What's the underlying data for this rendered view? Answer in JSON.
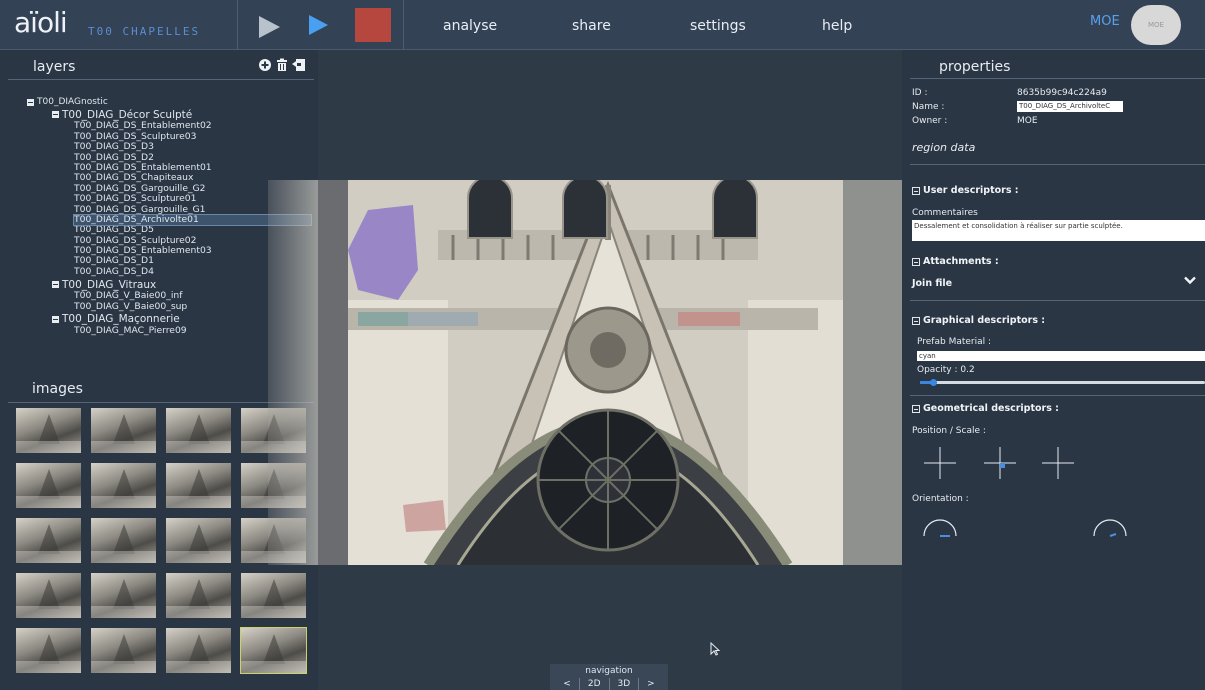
{
  "app": {
    "logo": "aïoli",
    "project": "T00 CHAPELLES",
    "accent": "#5a8ed0",
    "stop_color": "#b5473f"
  },
  "menu": [
    "analyse",
    "share",
    "settings",
    "help"
  ],
  "user": {
    "label": "MOE",
    "avatar": "MOE"
  },
  "layers": {
    "title": "layers",
    "actions": [
      "add-icon",
      "trash-icon",
      "import-icon"
    ],
    "root": "T00_DIAGnostic",
    "groups": [
      {
        "label": "T00_DIAG_Décor Sculpté",
        "items": [
          "T00_DIAG_DS_Entablement02",
          "T00_DIAG_DS_Sculpture03",
          "T00_DIAG_DS_D3",
          "T00_DIAG_DS_D2",
          "T00_DIAG_DS_Entablement01",
          "T00_DIAG_DS_Chapiteaux",
          "T00_DIAG_DS_Gargouille_G2",
          "T00_DIAG_DS_Sculpture01",
          "T00_DIAG_DS_Gargouille_G1",
          "T00_DIAG_DS_Archivolte01",
          "T00_DIAG_DS_D5",
          "T00_DIAG_DS_Sculpture02",
          "T00_DIAG_DS_Entablement03",
          "T00_DIAG_DS_D1",
          "T00_DIAG_DS_D4"
        ],
        "selected_index": 9
      },
      {
        "label": "T00_DIAG_Vitraux",
        "items": [
          "T00_DIAG_V_Baie00_inf",
          "T00_DIAG_V_Baie00_sup"
        ]
      },
      {
        "label": "T00_DIAG_Maçonnerie",
        "items": [
          "T00_DIAG_MAC_Pierre09"
        ]
      }
    ]
  },
  "images": {
    "title": "images",
    "count": 20,
    "selected_index": 19
  },
  "navigation": {
    "label": "navigation",
    "buttons": [
      "<",
      "2D",
      "3D",
      ">"
    ]
  },
  "properties": {
    "title": "properties",
    "id_label": "ID :",
    "id_value": "8635b99c94c224a9",
    "name_label": "Name :",
    "name_value": "T00_DIAG_DS_ArchivolteC",
    "owner_label": "Owner :",
    "owner_value": "MOE",
    "region_data": "region data",
    "user_descriptors": "User descriptors :",
    "comment_label": "Commentaires",
    "comment_value": "Dessalement et consolidation à réaliser sur partie sculptée.",
    "attachments": "Attachments :",
    "join_file": "Join file",
    "graphical_descriptors": "Graphical descriptors :",
    "prefab_label": "Prefab Material :",
    "prefab_value": "cyan",
    "opacity_label": "Opacity : 0.2",
    "opacity_value": 0.2,
    "geometrical_descriptors": "Geometrical descriptors :",
    "position_label": "Position / Scale :",
    "orientation_label": "Orientation :"
  }
}
